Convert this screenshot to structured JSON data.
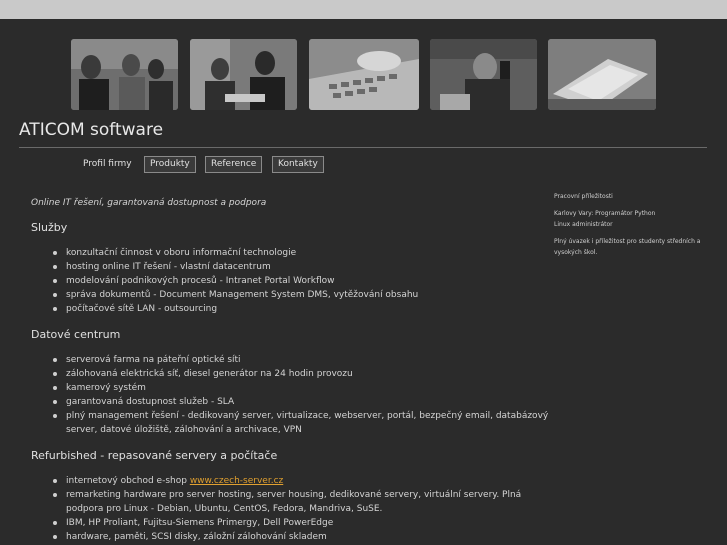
{
  "nav": {
    "items": [
      "Profil firmy",
      "Produkty",
      "Reference",
      "Kontakty"
    ]
  },
  "header": {
    "logo": "ATICOM software"
  },
  "main": {
    "tagline": "Online IT řešení, garantovaná dostupnost a podpora",
    "sections": [
      {
        "heading": "Služby",
        "items": [
          "konzultační činnost v oboru informační technologie",
          "hosting online IT řešení - vlastní datacentrum",
          "modelování podnikových procesů - Intranet Portal Workflow",
          "správa dokumentů - Document Management System DMS, vytěžování obsahu",
          "počítačové sítě LAN - outsourcing"
        ]
      },
      {
        "heading": "Datové centrum",
        "items": [
          "serverová farma na páteřní optické síti",
          "zálohovaná elektrická síť, diesel generátor na 24 hodin provozu",
          "kamerový systém",
          "garantovaná dostupnost služeb - SLA",
          "plný management řešení - dedikovaný server, virtualizace, webserver, portál, bezpečný email, databázový server, datové úložiště, zálohování a archivace, VPN"
        ]
      },
      {
        "heading": "Refurbished - repasované servery a počítače",
        "eshop_prefix": "internetový obchod e-shop ",
        "eshop_link": "www.czech-server.cz",
        "items": [
          "remarketing hardware pro server hosting, server housing, dedikované servery, virtuální servery. Plná podpora pro Linux - Debian, Ubuntu, CentOS, Fedora, Mandriva, SuSE.",
          "IBM, HP Proliant, Fujitsu-Siemens Primergy, Dell PowerEdge",
          "hardware, paměti, SCSI disky, záložní zálohování skladem"
        ]
      }
    ]
  },
  "sidebar": {
    "title": "Pracovní příležitosti",
    "job": "Karlovy Vary: Programátor Python",
    "job2": "Linux administrátor",
    "note": "Plný úvazek i příležitost pro studenty středních a vysokých škol."
  }
}
